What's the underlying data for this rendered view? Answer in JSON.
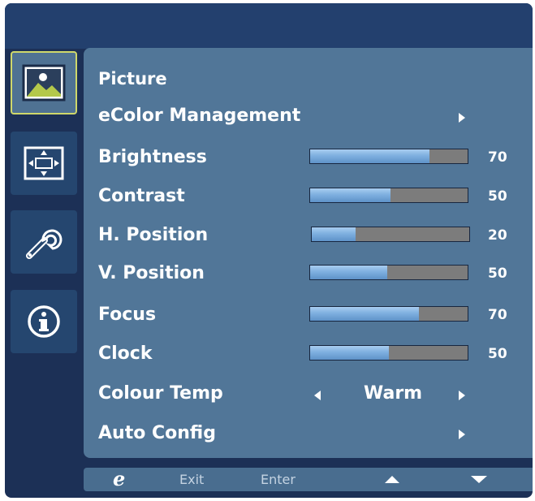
{
  "colors": {
    "frame": "#1c3056",
    "panel": "#517698",
    "tab": "#25466f",
    "tab_active_border": "#cfd86a",
    "slider_fill": "#7fb0e0",
    "slider_track": "#7c7c7c",
    "text": "#ffffff"
  },
  "sidebar": {
    "tabs": [
      {
        "icon": "picture-icon",
        "active": true
      },
      {
        "icon": "screen-position-icon",
        "active": false
      },
      {
        "icon": "wrench-icon",
        "active": false
      },
      {
        "icon": "info-icon",
        "active": false
      }
    ]
  },
  "menu": {
    "title": "Picture",
    "ecolor": {
      "label": "eColor Management"
    },
    "sliders": [
      {
        "label": "Brightness",
        "value": 70,
        "display": "70",
        "fill": 0.76
      },
      {
        "label": "Contrast",
        "value": 50,
        "display": "50",
        "fill": 0.51
      },
      {
        "label": "H. Position",
        "value": 20,
        "display": "20",
        "fill": 0.28
      },
      {
        "label": "V. Position",
        "value": 50,
        "display": "50",
        "fill": 0.49
      },
      {
        "label": "Focus",
        "value": 70,
        "display": "70",
        "fill": 0.69
      },
      {
        "label": "Clock",
        "value": 50,
        "display": "50",
        "fill": 0.5
      }
    ],
    "colour_temp": {
      "label": "Colour Temp",
      "value": "Warm"
    },
    "auto_config": {
      "label": "Auto Config"
    }
  },
  "keys": {
    "logo": "e",
    "exit": "Exit",
    "enter": "Enter",
    "up_icon": "triangle-up-icon",
    "down_icon": "triangle-down-icon"
  }
}
